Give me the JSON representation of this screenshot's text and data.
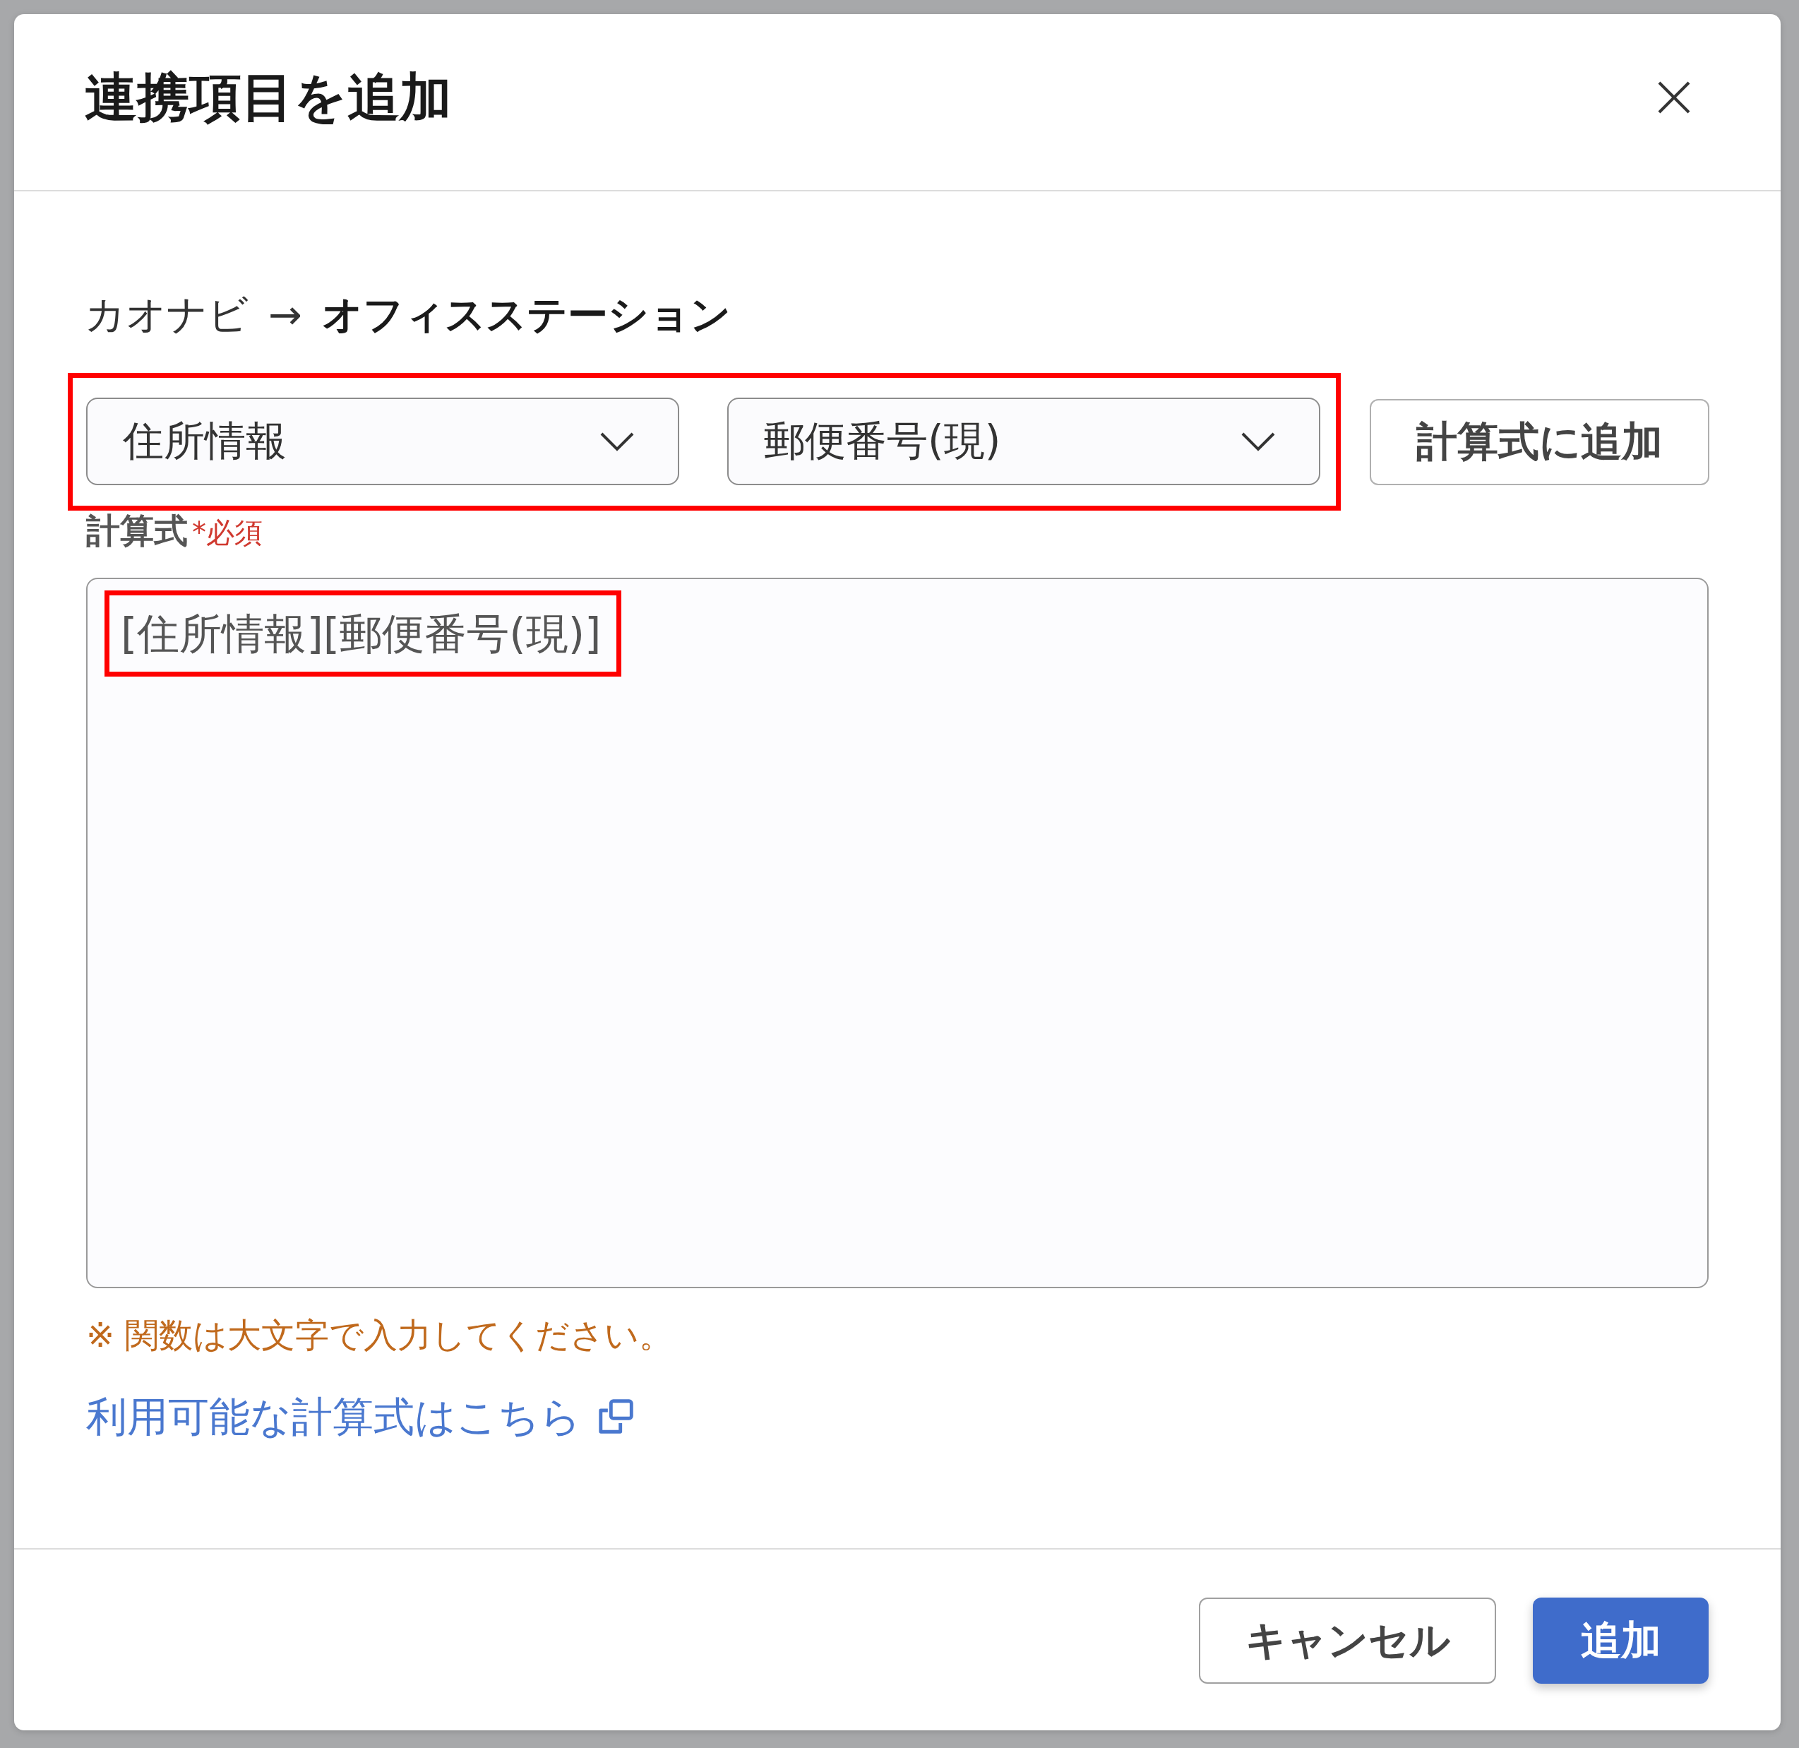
{
  "dialog": {
    "title": "連携項目を追加"
  },
  "mapping": {
    "source": "カオナビ",
    "arrow": "→",
    "target": "オフィスステーション"
  },
  "selectors": {
    "highlighted": true,
    "dropdowns": [
      {
        "value": "住所情報"
      },
      {
        "value": "郵便番号(現)"
      }
    ]
  },
  "add_to_formula_button": "計算式に追加",
  "formula": {
    "label": "計算式",
    "required_text": "*必須",
    "value": "[住所情報][郵便番号(現)]",
    "highlighted": true
  },
  "note": "※ 関数は大文字で入力してください。",
  "help_link": {
    "text": "利用可能な計算式はこちら",
    "external": true
  },
  "footer": {
    "buttons": [
      {
        "label": "キャンセル",
        "kind": "secondary"
      },
      {
        "label": "追加",
        "kind": "primary"
      }
    ]
  }
}
